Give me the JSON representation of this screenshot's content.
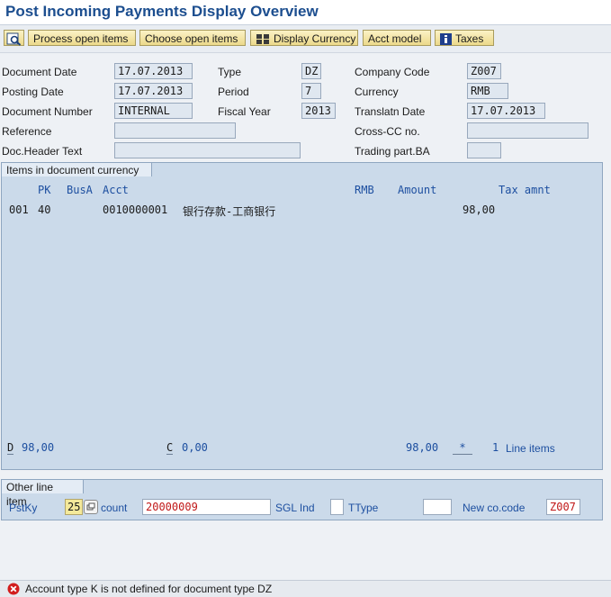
{
  "window": {
    "title": "Post Incoming Payments Display Overview"
  },
  "toolbar": {
    "process_open_items": "Process open items",
    "choose_open_items": "Choose open items",
    "display_currency": "Display Currency",
    "acct_model": "Acct model",
    "taxes": "Taxes"
  },
  "header": {
    "document_date": {
      "label": "Document Date",
      "value": "17.07.2013"
    },
    "type": {
      "label": "Type",
      "value": "DZ"
    },
    "company_code": {
      "label": "Company Code",
      "value": "Z007"
    },
    "posting_date": {
      "label": "Posting Date",
      "value": "17.07.2013"
    },
    "period": {
      "label": "Period",
      "value": "7"
    },
    "currency": {
      "label": "Currency",
      "value": "RMB"
    },
    "document_number": {
      "label": "Document Number",
      "value": "INTERNAL"
    },
    "fiscal_year": {
      "label": "Fiscal Year",
      "value": "2013"
    },
    "translatn_date": {
      "label": "Translatn Date",
      "value": "17.07.2013"
    },
    "reference": {
      "label": "Reference",
      "value": ""
    },
    "cross_cc_no": {
      "label": "Cross-CC no.",
      "value": ""
    },
    "doc_header_text": {
      "label": "Doc.Header Text",
      "value": ""
    },
    "trading_part_ba": {
      "label": "Trading part.BA",
      "value": ""
    }
  },
  "items": {
    "tab_label": "Items in document currency",
    "columns": {
      "pk": "PK",
      "busa": "BusA",
      "acct": "Acct",
      "rmb": "RMB",
      "amount": "Amount",
      "tax_amnt": "Tax amnt"
    },
    "rows": [
      {
        "line": "001",
        "pk": "40",
        "acct": "0010000001",
        "text": "银行存款-工商银行",
        "amount": "98,00"
      }
    ],
    "totals": {
      "d_label": "D",
      "d_value": "98,00",
      "c_label": "C",
      "c_value": "0,00",
      "balance": "98,00",
      "star": "*",
      "line_count": "1",
      "line_items_label": "Line items"
    }
  },
  "other_line_item": {
    "tab_label": "Other line item",
    "pstky_label": "PstKy",
    "pstky_value": "25",
    "account_label": "count",
    "account_value": "20000009",
    "sgl_ind_label": "SGL Ind",
    "sgl_ind_value": "",
    "ttype_label": "TType",
    "ttype_value": "",
    "new_co_code_label": "New co.code",
    "new_co_code_value": "Z007"
  },
  "status": {
    "message": "Account type K is not defined for document type DZ"
  },
  "colors": {
    "title": "#1c4e8f",
    "panel": "#cbdaea",
    "field": "#dfe7f0",
    "error": "#d21d1d",
    "link_blue": "#1d4fa0"
  }
}
